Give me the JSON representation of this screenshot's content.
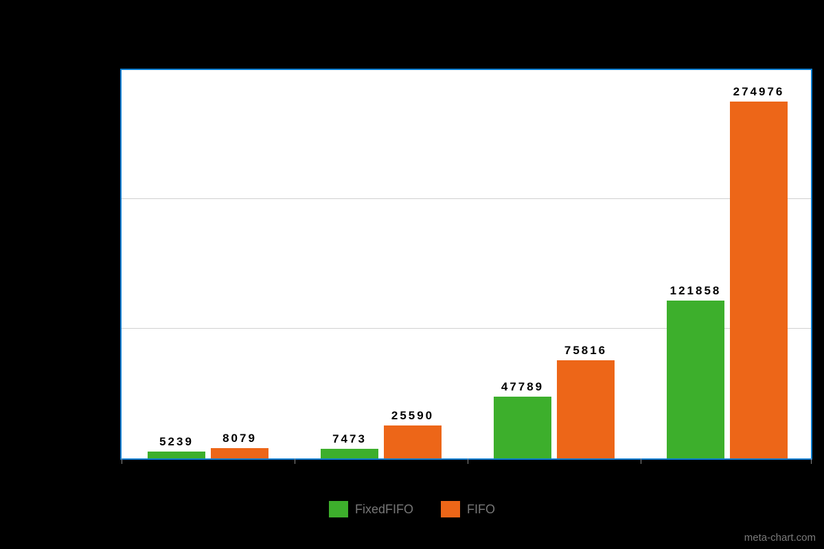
{
  "chart_data": {
    "type": "bar",
    "categories": [
      "",
      "",
      "",
      ""
    ],
    "series": [
      {
        "name": "FixedFIFO",
        "values": [
          5239,
          7473,
          47789,
          121858
        ],
        "color": "#3daf2c"
      },
      {
        "name": "FIFO",
        "values": [
          8079,
          25590,
          75816,
          274976
        ],
        "color": "#ed6618"
      }
    ],
    "ylim": [
      0,
      300000
    ],
    "gridlines_y": [
      0,
      100000,
      200000,
      300000
    ],
    "xlabel": "",
    "ylabel": "",
    "title": ""
  },
  "legend": {
    "items": [
      {
        "label": "FixedFIFO",
        "color": "#3daf2c"
      },
      {
        "label": "FIFO",
        "color": "#ed6618"
      }
    ]
  },
  "watermark": "meta-chart.com",
  "labels": {
    "g0_s0": "5239",
    "g0_s1": "8079",
    "g1_s0": "7473",
    "g1_s1": "25590",
    "g2_s0": "47789",
    "g2_s1": "75816",
    "g3_s0": "121858",
    "g3_s1": "274976"
  }
}
